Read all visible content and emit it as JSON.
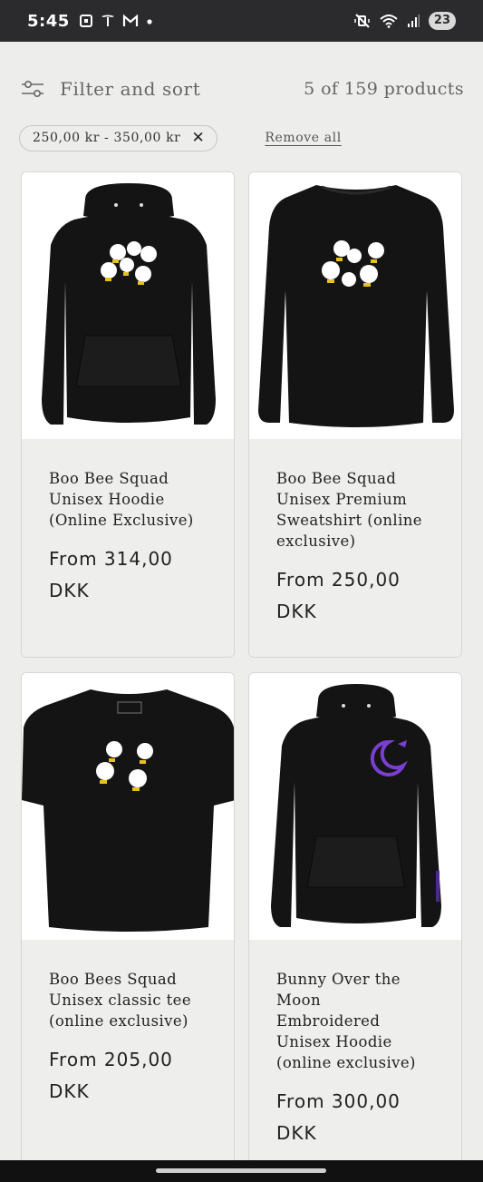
{
  "status_bar": {
    "time": "5:45",
    "left_icons": [
      "screenshot-icon",
      "tesla-icon",
      "gmail-icon",
      "dot-icon"
    ],
    "right_icons": [
      "mute-vibrate-icon",
      "wifi-icon",
      "signal-icon"
    ],
    "battery": "23"
  },
  "toolbar": {
    "filter_label": "Filter and sort",
    "count": "5 of 159 products"
  },
  "active_filters": {
    "chip_label": "250,00 kr - 350,00 kr",
    "remove_all": "Remove all"
  },
  "products": [
    {
      "title_lines": [
        "Boo Bee Squad",
        "Unisex Hoodie",
        "(Online Exclusive)"
      ],
      "price": "From 314,00 DKK",
      "image": "black-hoodie-bees"
    },
    {
      "title_lines": [
        "Boo Bee Squad",
        "Unisex Premium",
        "Sweatshirt (online",
        "exclusive)"
      ],
      "price": "From 250,00 DKK",
      "image": "black-sweatshirt-bees"
    },
    {
      "title_lines": [
        "Boo Bees Squad",
        "Unisex classic tee",
        "(online exclusive)"
      ],
      "price": "From 205,00 DKK",
      "image": "black-tee-bees"
    },
    {
      "title_lines": [
        "Bunny Over the",
        "Moon",
        "Embroidered",
        "Unisex Hoodie",
        "(online exclusive)"
      ],
      "price": "From 300,00 DKK",
      "image": "black-hoodie-purple-moon"
    }
  ],
  "colors": {
    "background": "#ededeb",
    "status_bar": "#2b2b2d",
    "garment": "#141414",
    "bee_yellow": "#e8c21a",
    "moon_purple": "#7a3fd0"
  }
}
